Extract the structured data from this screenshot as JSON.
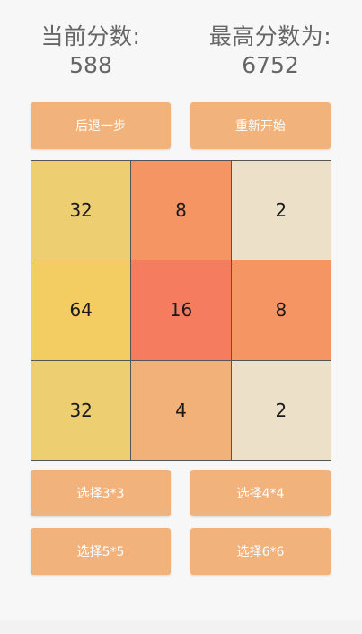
{
  "scores": {
    "current_label": "当前分数:",
    "current_value": "588",
    "best_label": "最高分数为:",
    "best_value": "6752"
  },
  "buttons": {
    "undo": "后退一步",
    "restart": "重新开始",
    "size3": "选择3*3",
    "size4": "选择4*4",
    "size5": "选择5*5",
    "size6": "选择6*6"
  },
  "board": {
    "tiles": [
      "32",
      "8",
      "2",
      "64",
      "16",
      "8",
      "32",
      "4",
      "2"
    ],
    "tile_colors": [
      "#edcf72",
      "#f59563",
      "#ede0c8",
      "#f3cd62",
      "#f67c5f",
      "#f59563",
      "#edcf72",
      "#f2b179",
      "#ede0c8"
    ]
  },
  "colors": {
    "button": "#f2b27b",
    "background": "#f7f7f7",
    "grid_line": "#555555"
  }
}
